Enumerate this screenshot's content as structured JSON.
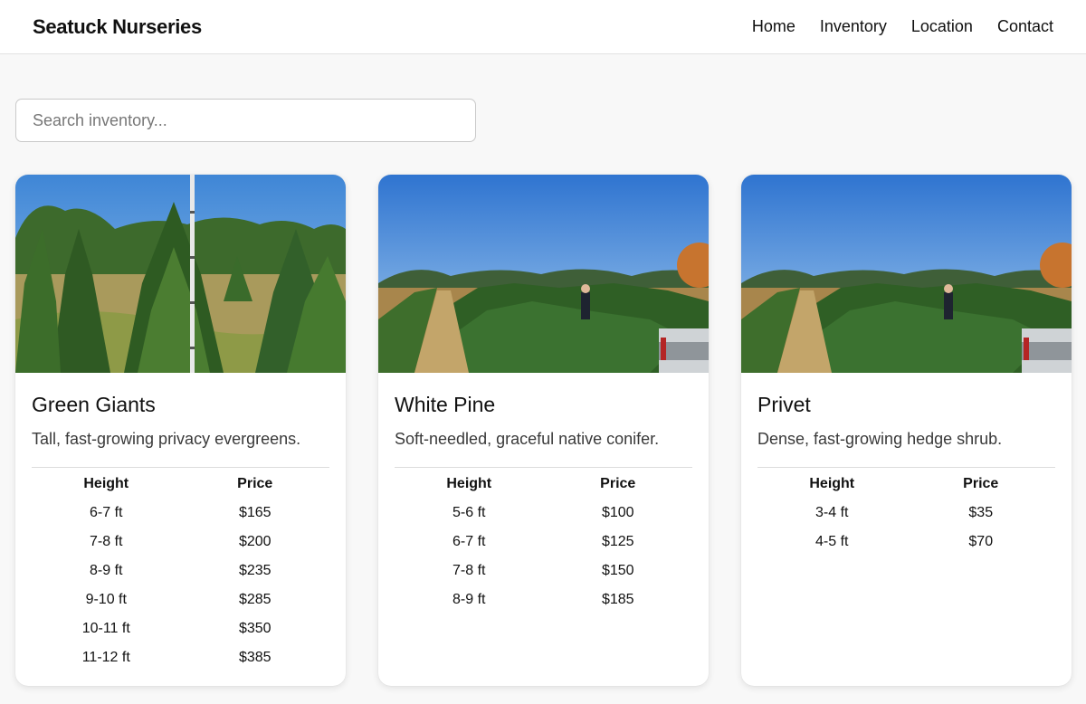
{
  "header": {
    "brand": "Seatuck Nurseries",
    "nav": [
      "Home",
      "Inventory",
      "Location",
      "Contact"
    ]
  },
  "search": {
    "placeholder": "Search inventory..."
  },
  "table_headers": {
    "height": "Height",
    "price": "Price"
  },
  "cards": [
    {
      "title": "Green Giants",
      "description": "Tall, fast-growing privacy evergreens.",
      "photo": "arborvitae-rows-with-measuring-pole",
      "rows": [
        [
          "6-7 ft",
          "$165"
        ],
        [
          "7-8 ft",
          "$200"
        ],
        [
          "8-9 ft",
          "$235"
        ],
        [
          "9-10 ft",
          "$285"
        ],
        [
          "10-11 ft",
          "$350"
        ],
        [
          "11-12 ft",
          "$385"
        ]
      ]
    },
    {
      "title": "White Pine",
      "description": "Soft-needled, graceful native conifer.",
      "photo": "pine-rows-field-with-person-and-truck",
      "rows": [
        [
          "5-6 ft",
          "$100"
        ],
        [
          "6-7 ft",
          "$125"
        ],
        [
          "7-8 ft",
          "$150"
        ],
        [
          "8-9 ft",
          "$185"
        ]
      ]
    },
    {
      "title": "Privet",
      "description": "Dense, fast-growing hedge shrub.",
      "photo": "pine-rows-field-with-person-and-truck",
      "rows": [
        [
          "3-4 ft",
          "$35"
        ],
        [
          "4-5 ft",
          "$70"
        ]
      ]
    }
  ]
}
